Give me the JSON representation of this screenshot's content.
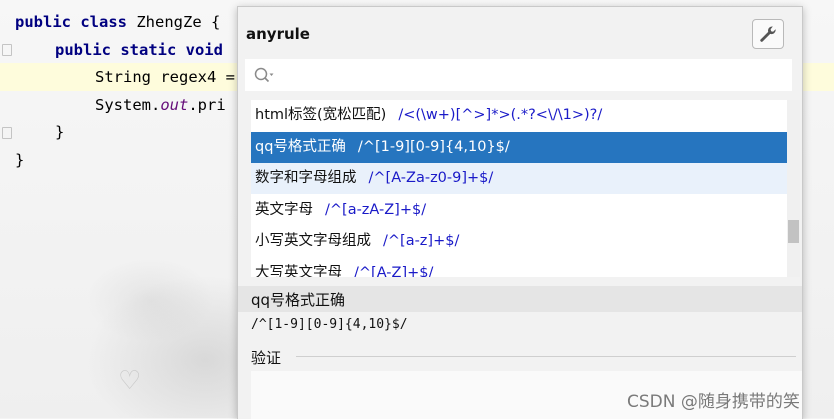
{
  "editor": {
    "lines": [
      {
        "parts": [
          {
            "t": "public class ",
            "c": "kw"
          },
          {
            "t": "ZhengZe {",
            "c": "plain"
          }
        ]
      },
      {
        "parts": [
          {
            "t": "public static void",
            "c": "kw"
          }
        ]
      },
      {
        "parts": [
          {
            "t": "String regex4 =",
            "c": "plain"
          }
        ]
      },
      {
        "parts": [
          {
            "t": "System.",
            "c": "plain"
          },
          {
            "t": "out",
            "c": "field"
          },
          {
            "t": ".pri",
            "c": "plain"
          }
        ]
      },
      {
        "parts": [
          {
            "t": "}",
            "c": "plain"
          }
        ]
      },
      {
        "parts": [
          {
            "t": "}",
            "c": "plain"
          }
        ]
      }
    ]
  },
  "popup": {
    "title": "anyrule",
    "settings_icon": "wrench-icon",
    "search": {
      "placeholder": "",
      "value": ""
    },
    "rules": [
      {
        "name": "html标签(宽松匹配)",
        "pattern": "/<(\\w+)[^>]*>(.*?<\\/\\1>)?/"
      },
      {
        "name": "qq号格式正确",
        "pattern": "/^[1-9][0-9]{4,10}$/"
      },
      {
        "name": "数字和字母组成",
        "pattern": "/^[A-Za-z0-9]+$/"
      },
      {
        "name": "英文字母",
        "pattern": "/^[a-zA-Z]+$/"
      },
      {
        "name": "小写英文字母组成",
        "pattern": "/^[a-z]+$/"
      },
      {
        "name": "大写英文字母",
        "pattern": "/^[A-Z]+$/"
      }
    ],
    "selected_index": 1,
    "hover_index": 2,
    "detail": {
      "name": "qq号格式正确",
      "pattern": "/^[1-9][0-9]{4,10}$/",
      "verify_label": "验证"
    }
  },
  "watermark": "CSDN @随身携带的笑",
  "colors": {
    "selection": "#2675bf",
    "pattern_text": "#1a1ac8",
    "keyword": "#000080"
  }
}
